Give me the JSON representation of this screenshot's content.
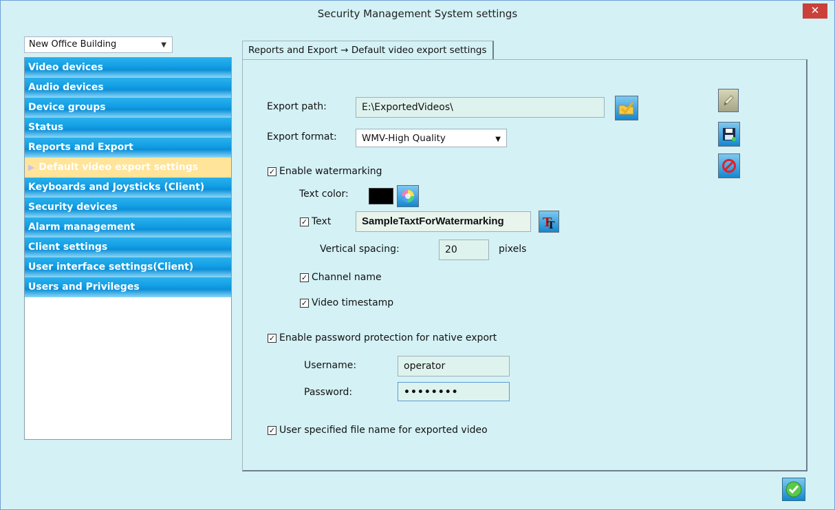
{
  "window": {
    "title": "Security Management System settings",
    "close_label": "✕"
  },
  "sidebar": {
    "site": "New Office Building",
    "items": [
      {
        "label": "Video devices"
      },
      {
        "label": "Audio devices"
      },
      {
        "label": "Device groups"
      },
      {
        "label": "Status"
      },
      {
        "label": "Reports and Export"
      },
      {
        "label": "Default video export settings",
        "selected": true
      },
      {
        "label": "Keyboards and Joysticks (Client)"
      },
      {
        "label": "Security devices"
      },
      {
        "label": "Alarm management"
      },
      {
        "label": "Client settings"
      },
      {
        "label": "User interface settings(Client)"
      },
      {
        "label": "Users and Privileges"
      }
    ]
  },
  "tab": {
    "label": "Reports and Export → Default video export settings"
  },
  "form": {
    "export_path_label": "Export path:",
    "export_path_value": "E:\\ExportedVideos\\",
    "export_format_label": "Export format:",
    "export_format_value": "WMV-High Quality",
    "watermark_label": "Enable watermarking",
    "watermark_checked": true,
    "text_color_label": "Text color:",
    "text_color_value": "#000000",
    "text_label": "Text",
    "text_checked": true,
    "text_value": "SampleTaxtForWatermarking",
    "vertical_spacing_label": "Vertical spacing:",
    "vertical_spacing_value": "20",
    "vertical_spacing_unit": "pixels",
    "channel_name_label": "Channel name",
    "channel_name_checked": true,
    "timestamp_label": "Video timestamp",
    "timestamp_checked": true,
    "password_protection_label": "Enable password protection for native export",
    "password_protection_checked": true,
    "username_label": "Username:",
    "username_value": "operator",
    "password_label": "Password:",
    "password_value": "••••••••",
    "user_filename_label": "User specified file name for exported video",
    "user_filename_checked": true
  },
  "icons": {
    "browse": "folder-check-icon",
    "color_picker": "color-wheel-icon",
    "font": "font-icon",
    "edit": "pencil-icon",
    "save": "save-icon",
    "cancel": "cancel-icon",
    "ok": "ok-check-icon"
  },
  "colors": {
    "nav_blue": "#14a0e6",
    "selected": "#ffe49a",
    "background": "#d4f1f5"
  }
}
